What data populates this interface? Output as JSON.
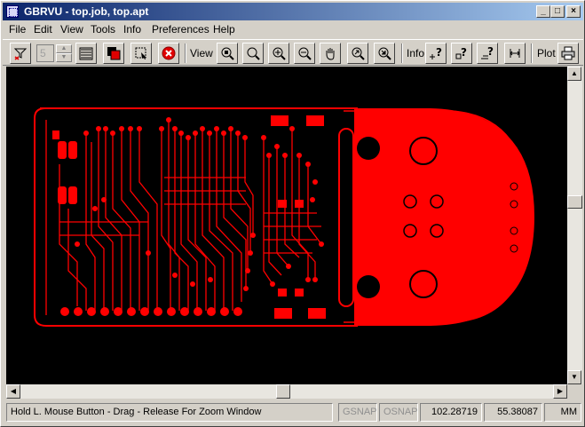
{
  "window": {
    "title": "GBRVU - top.job, top.apt"
  },
  "caption_buttons": {
    "minimize": "_",
    "maximize": "□",
    "close": "×"
  },
  "menu": [
    "File",
    "Edit",
    "View",
    "Tools",
    "Info",
    "Preferences",
    "Help"
  ],
  "toolbar": {
    "spin_value": "5",
    "view_label": "View",
    "info_label": "Info",
    "plot_label": "Plot",
    "icons": [
      "filter-icon",
      "layers-icon",
      "color-icon",
      "select-icon",
      "stop-icon",
      "zoom-fit-icon",
      "zoom-window-icon",
      "zoom-in-icon",
      "zoom-out-icon",
      "pan-hand-icon",
      "zoom-previous-icon",
      "zoom-all-icon",
      "info-point-icon",
      "info-query-icon",
      "info-box-icon",
      "info-line-icon",
      "measure-icon",
      "print-icon"
    ]
  },
  "colors": {
    "board": "#ff0000",
    "canvas": "#000000",
    "title_start": "#0a246a",
    "title_end": "#a6caf0"
  },
  "status": {
    "message": "Hold L. Mouse Button - Drag - Release For Zoom Window",
    "gsnap": "GSNAP",
    "osnap": "OSNAP",
    "x": "102.28719",
    "y": "55.38087",
    "units": "MM"
  }
}
